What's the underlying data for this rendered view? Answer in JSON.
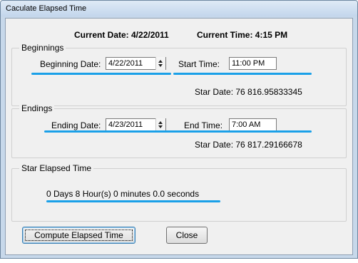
{
  "window": {
    "title": "Caculate Elapsed Time"
  },
  "header": {
    "current_date": "Current Date: 4/22/2011",
    "current_time": "Current Time: 4:15 PM"
  },
  "beginnings": {
    "title": "Beginnings",
    "date_label": "Beginning Date:",
    "date_value": "4/22/2011",
    "time_label": "Start Time:",
    "time_value": "11:00 PM",
    "star_date": "Star Date: 76 816.95833345"
  },
  "endings": {
    "title": "Endings",
    "date_label": "Ending Date:",
    "date_value": "4/23/2011",
    "time_label": "End Time:",
    "time_value": "7:00 AM",
    "star_date": "Star Date: 76 817.29166678"
  },
  "elapsed": {
    "title": "Star Elapsed Time",
    "result": "0 Days 8 Hour(s) 0 minutes 0.0 seconds"
  },
  "buttons": {
    "compute": "Compute Elapsed Time",
    "close": "Close"
  },
  "colors": {
    "annotation_underline": "#1aa0e8",
    "title_bar": "#c7d8ea"
  },
  "icons": {
    "spinner": "spin-up-down-icon"
  }
}
